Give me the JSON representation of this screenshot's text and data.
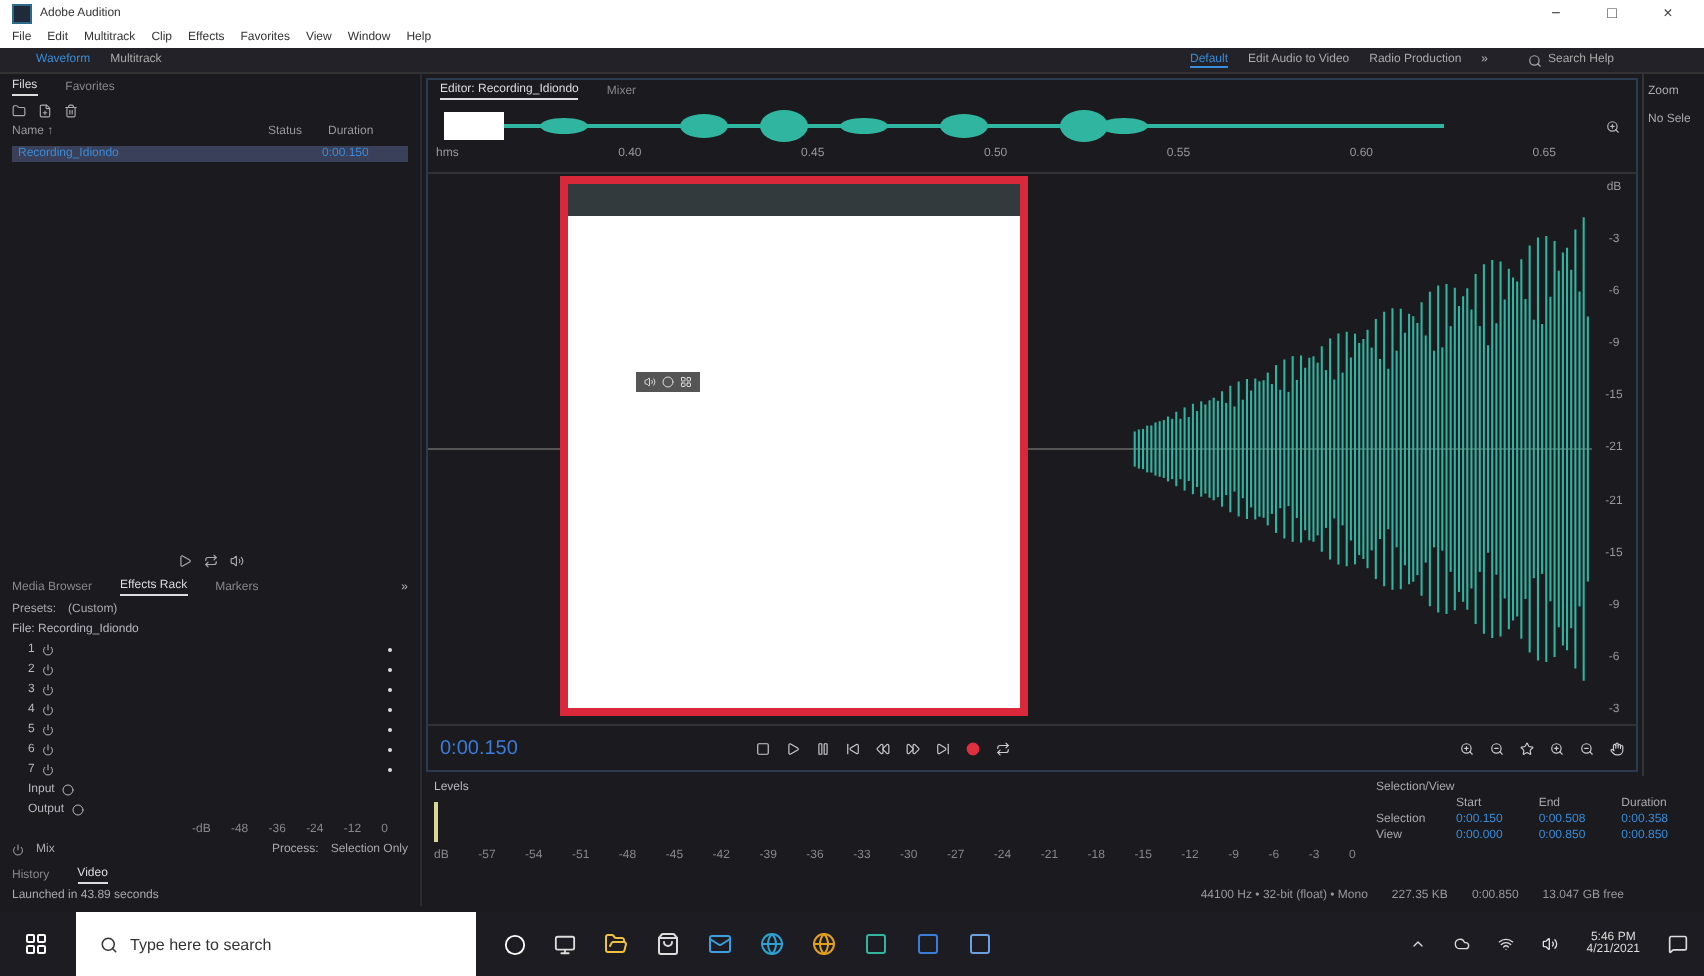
{
  "window": {
    "title": "Adobe Audition",
    "controls": [
      "−",
      "□",
      "×"
    ]
  },
  "menu": [
    "File",
    "Edit",
    "Multitrack",
    "Clip",
    "Effects",
    "Favorites",
    "View",
    "Window",
    "Help"
  ],
  "toolbar": {
    "modes": [
      {
        "label": "Waveform",
        "selected": true
      },
      {
        "label": "Multitrack",
        "selected": false
      }
    ],
    "workspaces": [
      {
        "label": "Default",
        "selected": true
      },
      {
        "label": "Edit Audio to Video",
        "selected": false
      },
      {
        "label": "Radio Production",
        "selected": false
      }
    ],
    "more": "»",
    "search": {
      "placeholder": "Search Help"
    }
  },
  "files_panel": {
    "tabs": [
      {
        "label": "Files",
        "selected": true
      },
      {
        "label": "Favorites",
        "selected": false
      }
    ],
    "columns": [
      "Name ↑",
      "Status",
      "Duration"
    ],
    "rows": [
      {
        "name": "Recording_Idiondo",
        "duration": "0:00.150",
        "selected": true
      }
    ]
  },
  "effects_panel": {
    "tabs": [
      {
        "label": "Media Browser",
        "selected": false
      },
      {
        "label": "Effects Rack",
        "selected": true
      },
      {
        "label": "Markers",
        "selected": false
      }
    ],
    "more": "»",
    "presets_label": "Presets:",
    "preset": "(Custom)",
    "file_label": "File: Recording_Idiondo",
    "slots": [
      "1",
      "2",
      "3",
      "4",
      "5",
      "6",
      "7"
    ],
    "io": [
      "Input",
      "Output"
    ],
    "meter_scale": [
      "-dB",
      "-48",
      "-36",
      "-24",
      "-12",
      "0"
    ],
    "mix_label": "Mix",
    "process_label": "Process:",
    "process": "Selection Only"
  },
  "history_panel": {
    "tabs": [
      {
        "label": "History",
        "selected": false
      },
      {
        "label": "Video",
        "selected": true
      }
    ],
    "status": "Launched in 43.89 seconds"
  },
  "editor": {
    "tabs": [
      {
        "label": "Editor: Recording_Idiondo",
        "selected": true
      },
      {
        "label": "Mixer",
        "selected": false
      }
    ],
    "ruler": [
      "hms",
      "0.40",
      "0.45",
      "0.50",
      "0.55",
      "0.60",
      "0.65"
    ],
    "db_scale": [
      "dB",
      "-3",
      "-6",
      "-9",
      "-15",
      "-21",
      "-21",
      "-15",
      "-9",
      "-6",
      "-3"
    ],
    "time": "0:00.150"
  },
  "right_panel": {
    "title": "Zoom",
    "text": "No Sele"
  },
  "levels": {
    "title": "Levels",
    "scale": [
      "dB",
      "-57",
      "-54",
      "-51",
      "-48",
      "-45",
      "-42",
      "-39",
      "-36",
      "-33",
      "-30",
      "-27",
      "-24",
      "-21",
      "-18",
      "-15",
      "-12",
      "-9",
      "-6",
      "-3",
      "0"
    ]
  },
  "selection_view": {
    "title": "Selection/View",
    "columns": [
      "Start",
      "End",
      "Duration"
    ],
    "rows": [
      {
        "label": "Selection",
        "values": [
          "0:00.150",
          "0:00.508",
          "0:00.358"
        ]
      },
      {
        "label": "View",
        "values": [
          "0:00.000",
          "0:00.850",
          "0:00.850"
        ]
      }
    ]
  },
  "status_bar": [
    "44100 Hz • 32-bit (float) • Mono",
    "227.35 KB",
    "0:00.850",
    "13.047 GB free"
  ],
  "taskbar": {
    "search_placeholder": "Type here to search",
    "time": "5:46 PM",
    "date": "4/21/2021"
  }
}
